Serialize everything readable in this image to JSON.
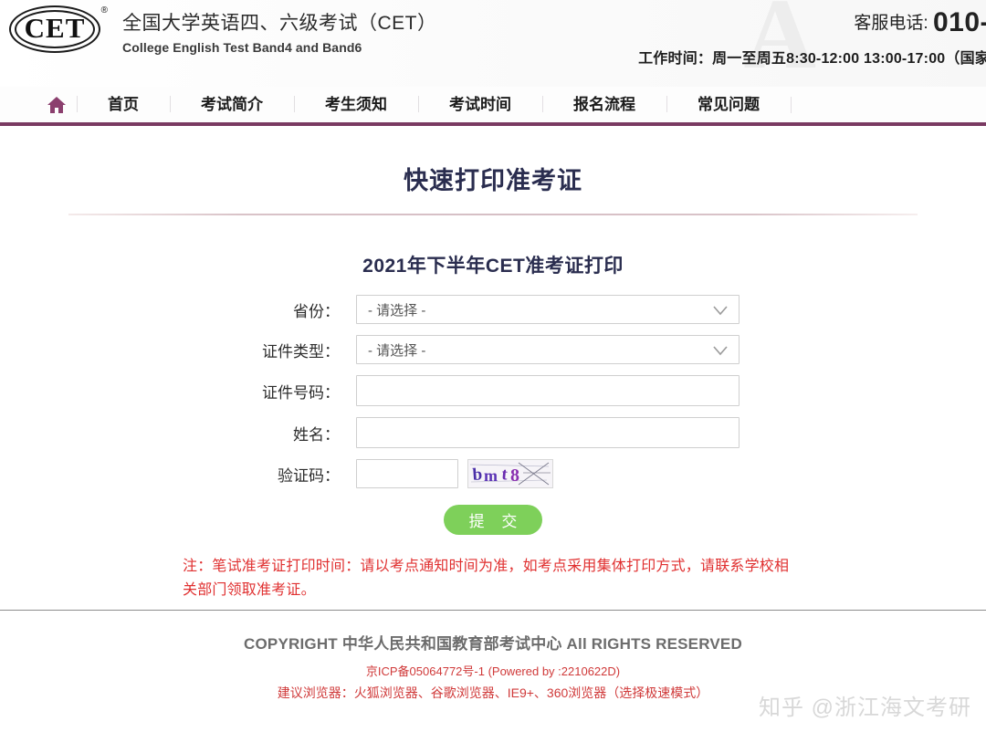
{
  "header": {
    "logo_text": "CET",
    "logo_reg": "®",
    "ghost_letter": "A",
    "brand_cn": "全国大学英语四、六级考试（CET）",
    "brand_en": "College English Test Band4 and Band6",
    "contact_label": "客服电话:",
    "contact_phone": "010-",
    "work_hours": "工作时间：周一至周五8:30-12:00 13:00-17:00（国家"
  },
  "nav": {
    "home_icon": "home-icon",
    "items": [
      {
        "label": "首页"
      },
      {
        "label": "考试简介"
      },
      {
        "label": "考生须知"
      },
      {
        "label": "考试时间"
      },
      {
        "label": "报名流程"
      },
      {
        "label": "常见问题"
      }
    ]
  },
  "main": {
    "page_title": "快速打印准考证",
    "form_title": "2021年下半年CET准考证打印",
    "fields": {
      "province_label": "省份：",
      "province_value": "- 请选择 -",
      "id_type_label": "证件类型：",
      "id_type_value": "- 请选择 -",
      "id_number_label": "证件号码：",
      "id_number_value": "",
      "id_number_placeholder": "",
      "name_label": "姓名：",
      "name_value": "",
      "name_placeholder": "",
      "captcha_label": "验证码：",
      "captcha_value": "",
      "captcha_placeholder": "",
      "captcha_image_text": "bmt8"
    },
    "submit_label": "提 交",
    "note": "注：笔试准考证打印时间：请以考点通知时间为准，如考点采用集体打印方式，请联系学校相关部门领取准考证。"
  },
  "footer": {
    "copyright": "COPYRIGHT 中华人民共和国教育部考试中心 All RIGHTS RESERVED",
    "icp": "京ICP备05064772号-1 (Powered by :2210622D)",
    "browsers": "建议浏览器：火狐浏览器、谷歌浏览器、IE9+、360浏览器（选择极速模式）",
    "watermark": "知乎 @浙江海文考研"
  },
  "colors": {
    "nav_underline": "#7a3a62",
    "title_navy": "#2a2d4f",
    "note_red": "#e03030",
    "submit_green": "#7ed05a",
    "home_icon": "#8b3f6e"
  }
}
